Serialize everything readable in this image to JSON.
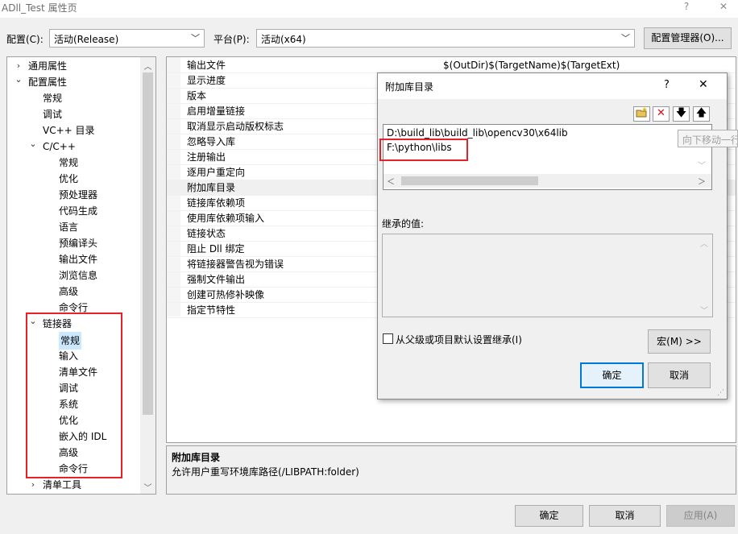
{
  "window": {
    "title": "ADll_Test 属性页",
    "help": "?",
    "close": "✕"
  },
  "config": {
    "config_label": "配置(C):",
    "config_value": "活动(Release)",
    "platform_label": "平台(P):",
    "platform_value": "活动(x64)",
    "manager_button": "配置管理器(O)..."
  },
  "tree": {
    "items": [
      {
        "label": "通用属性",
        "level": 0,
        "expander": "collapsed"
      },
      {
        "label": "配置属性",
        "level": 0,
        "expander": "expanded"
      },
      {
        "label": "常规",
        "level": 1,
        "expander": "none"
      },
      {
        "label": "调试",
        "level": 1,
        "expander": "none"
      },
      {
        "label": "VC++ 目录",
        "level": 1,
        "expander": "none"
      },
      {
        "label": "C/C++",
        "level": 1,
        "expander": "expanded"
      },
      {
        "label": "常规",
        "level": 2,
        "expander": "none"
      },
      {
        "label": "优化",
        "level": 2,
        "expander": "none"
      },
      {
        "label": "预处理器",
        "level": 2,
        "expander": "none"
      },
      {
        "label": "代码生成",
        "level": 2,
        "expander": "none"
      },
      {
        "label": "语言",
        "level": 2,
        "expander": "none"
      },
      {
        "label": "预编译头",
        "level": 2,
        "expander": "none"
      },
      {
        "label": "输出文件",
        "level": 2,
        "expander": "none"
      },
      {
        "label": "浏览信息",
        "level": 2,
        "expander": "none"
      },
      {
        "label": "高级",
        "level": 2,
        "expander": "none"
      },
      {
        "label": "命令行",
        "level": 2,
        "expander": "none"
      },
      {
        "label": "链接器",
        "level": 1,
        "expander": "expanded"
      },
      {
        "label": "常规",
        "level": 2,
        "expander": "none",
        "selected": true
      },
      {
        "label": "输入",
        "level": 2,
        "expander": "none"
      },
      {
        "label": "清单文件",
        "level": 2,
        "expander": "none"
      },
      {
        "label": "调试",
        "level": 2,
        "expander": "none"
      },
      {
        "label": "系统",
        "level": 2,
        "expander": "none"
      },
      {
        "label": "优化",
        "level": 2,
        "expander": "none"
      },
      {
        "label": "嵌入的 IDL",
        "level": 2,
        "expander": "none"
      },
      {
        "label": "高级",
        "level": 2,
        "expander": "none"
      },
      {
        "label": "命令行",
        "level": 2,
        "expander": "none"
      },
      {
        "label": "清单工具",
        "level": 1,
        "expander": "collapsed"
      }
    ]
  },
  "grid": {
    "rows": [
      {
        "name": "输出文件",
        "value": "$(OutDir)$(TargetName)$(TargetExt)"
      },
      {
        "name": "显示进度",
        "value": ""
      },
      {
        "name": "版本",
        "value": ""
      },
      {
        "name": "启用增量链接",
        "value": ""
      },
      {
        "name": "取消显示启动版权标志",
        "value": ""
      },
      {
        "name": "忽略导入库",
        "value": ""
      },
      {
        "name": "注册输出",
        "value": ""
      },
      {
        "name": "逐用户重定向",
        "value": ""
      },
      {
        "name": "附加库目录",
        "value": "",
        "highlight": true
      },
      {
        "name": "链接库依赖项",
        "value": ""
      },
      {
        "name": "使用库依赖项输入",
        "value": ""
      },
      {
        "name": "链接状态",
        "value": ""
      },
      {
        "name": "阻止 Dll 绑定",
        "value": ""
      },
      {
        "name": "将链接器警告视为错误",
        "value": ""
      },
      {
        "name": "强制文件输出",
        "value": ""
      },
      {
        "name": "创建可热修补映像",
        "value": ""
      },
      {
        "name": "指定节特性",
        "value": ""
      }
    ]
  },
  "description": {
    "title": "附加库目录",
    "body": "允许用户重写环境库路径(/LIBPATH:folder)"
  },
  "footer": {
    "ok": "确定",
    "cancel": "取消",
    "apply": "应用(A)"
  },
  "dialog": {
    "title": "附加库目录",
    "help": "?",
    "close": "✕",
    "list_items": [
      "D:\\build_lib\\build_lib\\opencv30\\x64lib",
      "F:\\python\\libs"
    ],
    "inherited_label": "继承的值:",
    "inherit_checkbox_label": "从父级或项目默认设置继承(I)",
    "macro_button": "宏(M) >>",
    "ok": "确定",
    "cancel": "取消"
  },
  "tooltip": "向下移动一行",
  "icons": {
    "new_line": "folder-new-icon",
    "delete": "delete-icon",
    "move_down": "arrow-down-icon",
    "move_up": "arrow-up-icon"
  },
  "colors": {
    "highlight_box": "#e8202a",
    "selection": "#cce8ff",
    "accent": "#0078d7"
  }
}
